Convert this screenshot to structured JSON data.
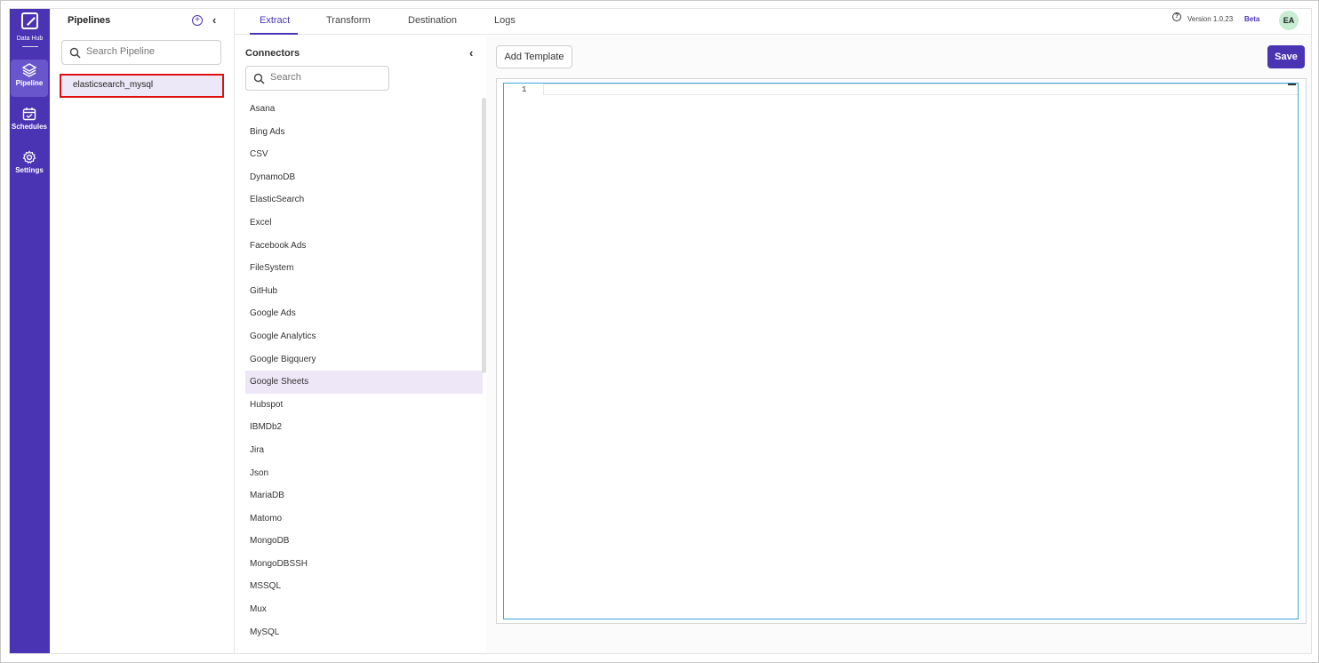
{
  "nav": {
    "logo_label": "Data Hub",
    "items": [
      {
        "label": "Pipeline",
        "icon": "layers-icon"
      },
      {
        "label": "Schedules",
        "icon": "calendar-icon"
      },
      {
        "label": "Settings",
        "icon": "gear-icon"
      }
    ]
  },
  "pipelines": {
    "title": "Pipelines",
    "search_placeholder": "Search Pipeline",
    "items": [
      "elasticsearch_mysql"
    ]
  },
  "tabs": [
    "Extract",
    "Transform",
    "Destination",
    "Logs"
  ],
  "header": {
    "version": "Version 1.0.23",
    "badge": "Beta",
    "avatar_initials": "EA"
  },
  "connectors": {
    "title": "Connectors",
    "search_placeholder": "Search",
    "items": [
      "Asana",
      "Bing Ads",
      "CSV",
      "DynamoDB",
      "ElasticSearch",
      "Excel",
      "Facebook Ads",
      "FileSystem",
      "GitHub",
      "Google Ads",
      "Google Analytics",
      "Google Bigquery",
      "Google Sheets",
      "Hubspot",
      "IBMDb2",
      "Jira",
      "Json",
      "MariaDB",
      "Matomo",
      "MongoDB",
      "MongoDBSSH",
      "MSSQL",
      "Mux",
      "MySQL"
    ],
    "highlighted": "Google Sheets"
  },
  "editor": {
    "add_template_label": "Add Template",
    "save_label": "Save",
    "line_number": "1"
  },
  "colors": {
    "brand": "#4b34b3",
    "highlight_border": "#e01010",
    "editor_border": "#3aa7d8"
  }
}
